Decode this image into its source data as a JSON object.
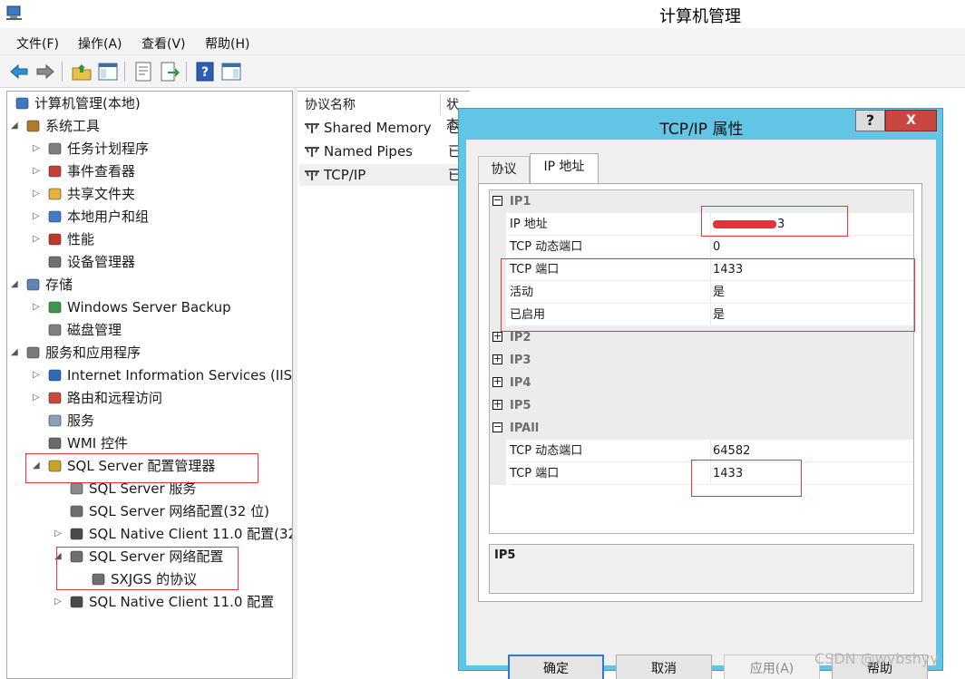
{
  "window": {
    "title": "计算机管理"
  },
  "menu": [
    "文件(F)",
    "操作(A)",
    "查看(V)",
    "帮助(H)"
  ],
  "toolbar": [
    "back-icon",
    "forward-icon",
    "up-folder-icon",
    "show-tree-icon",
    "properties-icon",
    "export-icon",
    "help-icon",
    "console-icon"
  ],
  "tree": [
    {
      "label": "计算机管理(本地)",
      "icon": "computer-management-icon",
      "expander": ""
    },
    {
      "label": "系统工具",
      "icon": "system-tools-icon",
      "expander": "◢"
    },
    {
      "label": "任务计划程序",
      "icon": "clock-icon",
      "expander": "▷"
    },
    {
      "label": "事件查看器",
      "icon": "event-viewer-icon",
      "expander": "▷"
    },
    {
      "label": "共享文件夹",
      "icon": "shared-folder-icon",
      "expander": "▷"
    },
    {
      "label": "本地用户和组",
      "icon": "users-icon",
      "expander": "▷"
    },
    {
      "label": "性能",
      "icon": "performance-icon",
      "expander": "▷"
    },
    {
      "label": "设备管理器",
      "icon": "device-manager-icon",
      "expander": ""
    },
    {
      "label": "存储",
      "icon": "storage-icon",
      "expander": "◢"
    },
    {
      "label": "Windows Server Backup",
      "icon": "backup-icon",
      "expander": "▷"
    },
    {
      "label": "磁盘管理",
      "icon": "disk-icon",
      "expander": ""
    },
    {
      "label": "服务和应用程序",
      "icon": "services-apps-icon",
      "expander": "◢"
    },
    {
      "label": "Internet Information Services (IIS",
      "icon": "iis-icon",
      "expander": "▷"
    },
    {
      "label": "路由和远程访问",
      "icon": "routing-icon",
      "expander": "▷"
    },
    {
      "label": "服务",
      "icon": "gear-icon",
      "expander": ""
    },
    {
      "label": "WMI 控件",
      "icon": "wmi-icon",
      "expander": ""
    },
    {
      "label": "SQL Server 配置管理器",
      "icon": "sql-config-icon",
      "expander": "◢"
    },
    {
      "label": "SQL Server 服务",
      "icon": "server-icon",
      "expander": ""
    },
    {
      "label": "SQL Server 网络配置(32 位)",
      "icon": "network-config-icon",
      "expander": ""
    },
    {
      "label": "SQL Native Client 11.0 配置(32",
      "icon": "client-config-icon",
      "expander": "▷"
    },
    {
      "label": "SQL Server 网络配置",
      "icon": "network-config-icon",
      "expander": "◢"
    },
    {
      "label": "SXJGS 的协议",
      "icon": "protocol-icon",
      "expander": ""
    },
    {
      "label": "SQL Native Client 11.0 配置",
      "icon": "client-config-icon",
      "expander": "▷"
    }
  ],
  "list": {
    "columns": [
      "协议名称",
      "状态"
    ],
    "rows": [
      {
        "name": "Shared Memory",
        "status": "已"
      },
      {
        "name": "Named Pipes",
        "status": "已"
      },
      {
        "name": "TCP/IP",
        "status": "已"
      }
    ]
  },
  "dialog": {
    "title": "TCP/IP 属性",
    "help_label": "?",
    "close_label": "X",
    "tabs": [
      "协议",
      "IP 地址"
    ],
    "grid": [
      {
        "type": "cat",
        "sign": "−",
        "label": "IP1"
      },
      {
        "type": "prop",
        "name": "IP 地址",
        "value": "3"
      },
      {
        "type": "prop",
        "name": "TCP 动态端口",
        "value": "0"
      },
      {
        "type": "prop",
        "name": "TCP 端口",
        "value": "1433"
      },
      {
        "type": "prop",
        "name": "活动",
        "value": "是"
      },
      {
        "type": "prop",
        "name": "已启用",
        "value": "是"
      },
      {
        "type": "cat",
        "sign": "+",
        "label": "IP2"
      },
      {
        "type": "cat",
        "sign": "+",
        "label": "IP3"
      },
      {
        "type": "cat",
        "sign": "+",
        "label": "IP4"
      },
      {
        "type": "cat",
        "sign": "+",
        "label": "IP5"
      },
      {
        "type": "cat",
        "sign": "−",
        "label": "IPAll"
      },
      {
        "type": "prop",
        "name": "TCP 动态端口",
        "value": "64582"
      },
      {
        "type": "prop",
        "name": "TCP 端口",
        "value": "1433"
      }
    ],
    "description_title": "IP5",
    "buttons": {
      "ok": "确定",
      "cancel": "取消",
      "apply": "应用(A)",
      "help": "帮助"
    }
  },
  "colors": {
    "dialog_frame": "#63c5e6",
    "highlight_box": "#e2383d",
    "close_button": "#c94740",
    "ok_border": "#2f79cf"
  },
  "watermark": "CSDN @wybshyy"
}
